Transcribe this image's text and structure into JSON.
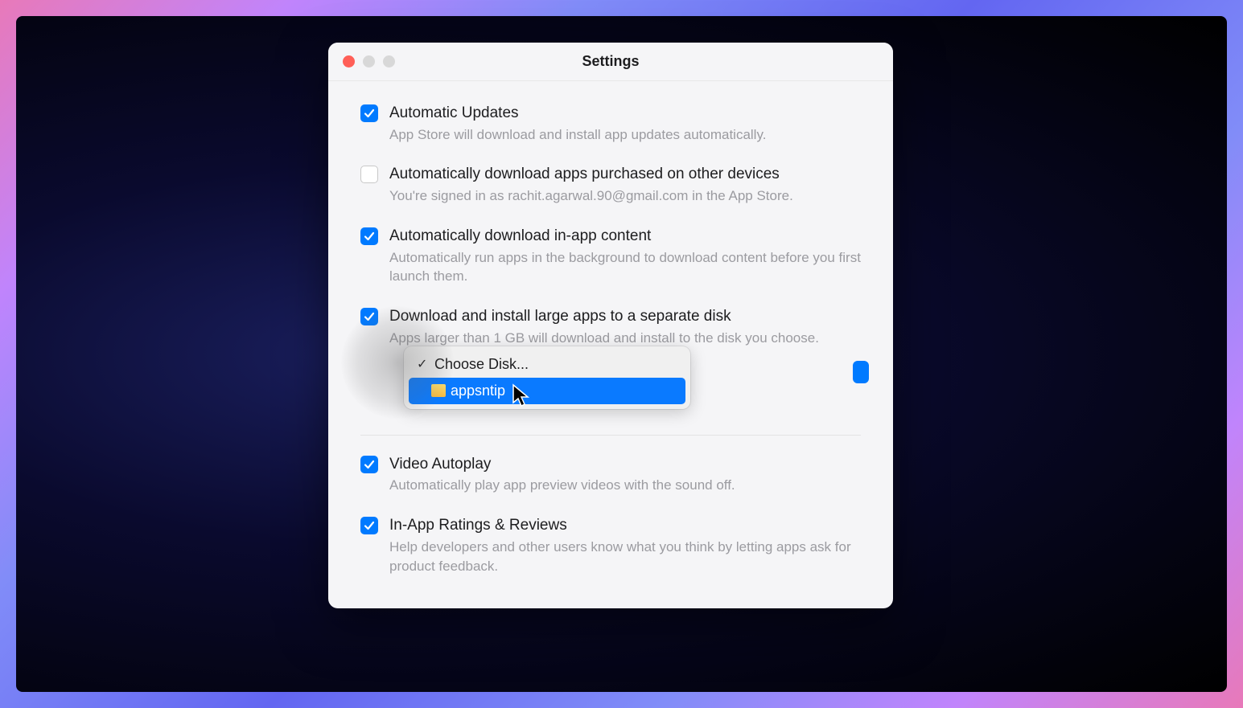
{
  "window": {
    "title": "Settings"
  },
  "settings": {
    "auto_updates": {
      "label": "Automatic Updates",
      "desc": "App Store will download and install app updates automatically.",
      "checked": true
    },
    "auto_download_purchased": {
      "label": "Automatically download apps purchased on other devices",
      "desc": "You're signed in as rachit.agarwal.90@gmail.com in the App Store.",
      "checked": false
    },
    "auto_inapp_content": {
      "label": "Automatically download in-app content",
      "desc": "Automatically run apps in the background to download content before you first launch them.",
      "checked": true
    },
    "large_apps_disk": {
      "label": "Download and install large apps to a separate disk",
      "desc": "Apps larger than 1 GB will download and install to the disk you choose.",
      "checked": true
    },
    "video_autoplay": {
      "label": "Video Autoplay",
      "desc": "Automatically play app preview videos with the sound off.",
      "checked": true
    },
    "ratings_reviews": {
      "label": "In-App Ratings & Reviews",
      "desc": "Help developers and other users know what you think by letting apps ask for product feedback.",
      "checked": true
    }
  },
  "dropdown": {
    "choose_disk_label": "Choose Disk...",
    "selected_disk": "appsntip"
  }
}
